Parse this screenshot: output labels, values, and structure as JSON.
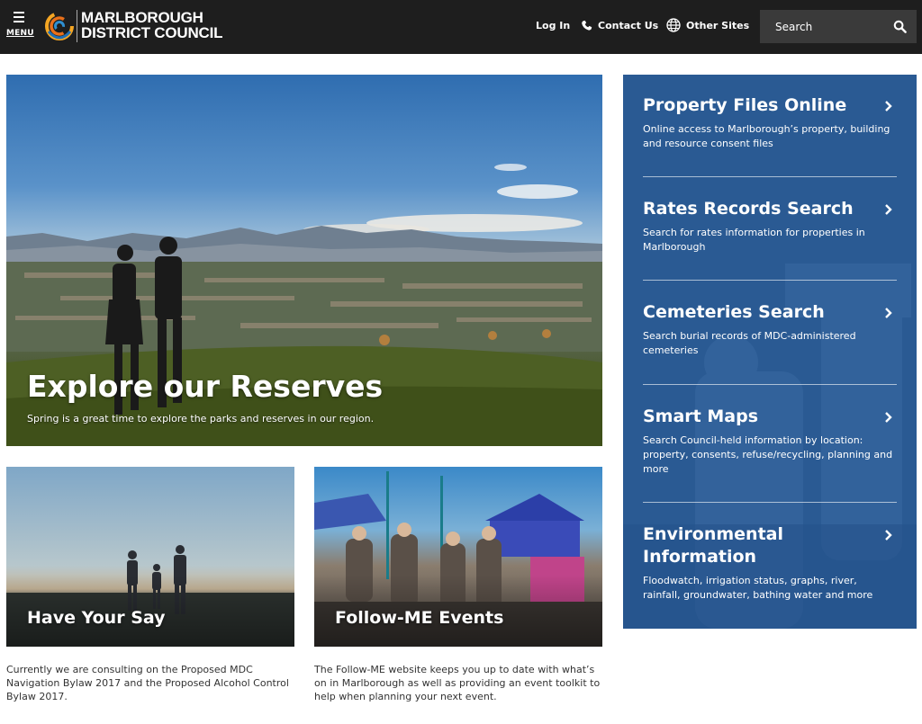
{
  "header": {
    "menu_label": "MENU",
    "logo_line1": "MARLBOROUGH",
    "logo_line2": "DISTRICT COUNCIL",
    "login_label": "Log In",
    "contact_label": "Contact Us",
    "other_sites_label": "Other Sites",
    "search_placeholder": "Search",
    "background_color": "#1e1e1e",
    "search_bg_color": "#3a3a3a"
  },
  "hero": {
    "title": "Explore our Reserves",
    "subtitle": "Spring is a great time to explore the parks and reserves in our region."
  },
  "cards": [
    {
      "title": "Have Your Say",
      "description": "Currently we are consulting on the Proposed MDC Navigation Bylaw 2017 and the Proposed Alcohol Control Bylaw 2017."
    },
    {
      "title": "Follow-ME Events",
      "description": "The Follow-ME website keeps you up to date with what’s on in Marlborough as well as providing an event toolkit to help when planning your next event."
    }
  ],
  "panel": {
    "background_color": "#2a5a93",
    "items": [
      {
        "title": "Property Files Online",
        "description": "Online access to Marlborough’s property, building and resource consent files"
      },
      {
        "title": "Rates Records Search",
        "description": "Search for rates information for properties in Marlborough"
      },
      {
        "title": "Cemeteries Search",
        "description": "Search burial records of MDC-administered cemeteries"
      },
      {
        "title": "Smart Maps",
        "description": "Search Council-held information by location: property, consents, refuse/recycling, planning and more"
      },
      {
        "title": "Environmental Information",
        "description": "Floodwatch, irrigation status, graphs, river, rainfall, groundwater, bathing water and more"
      }
    ]
  },
  "icons": {
    "menu": "hamburger-icon",
    "logo": "council-swirl-logo",
    "phone": "phone-icon",
    "globe": "globe-icon",
    "search": "search-icon",
    "chevron": "chevron-right-icon"
  }
}
